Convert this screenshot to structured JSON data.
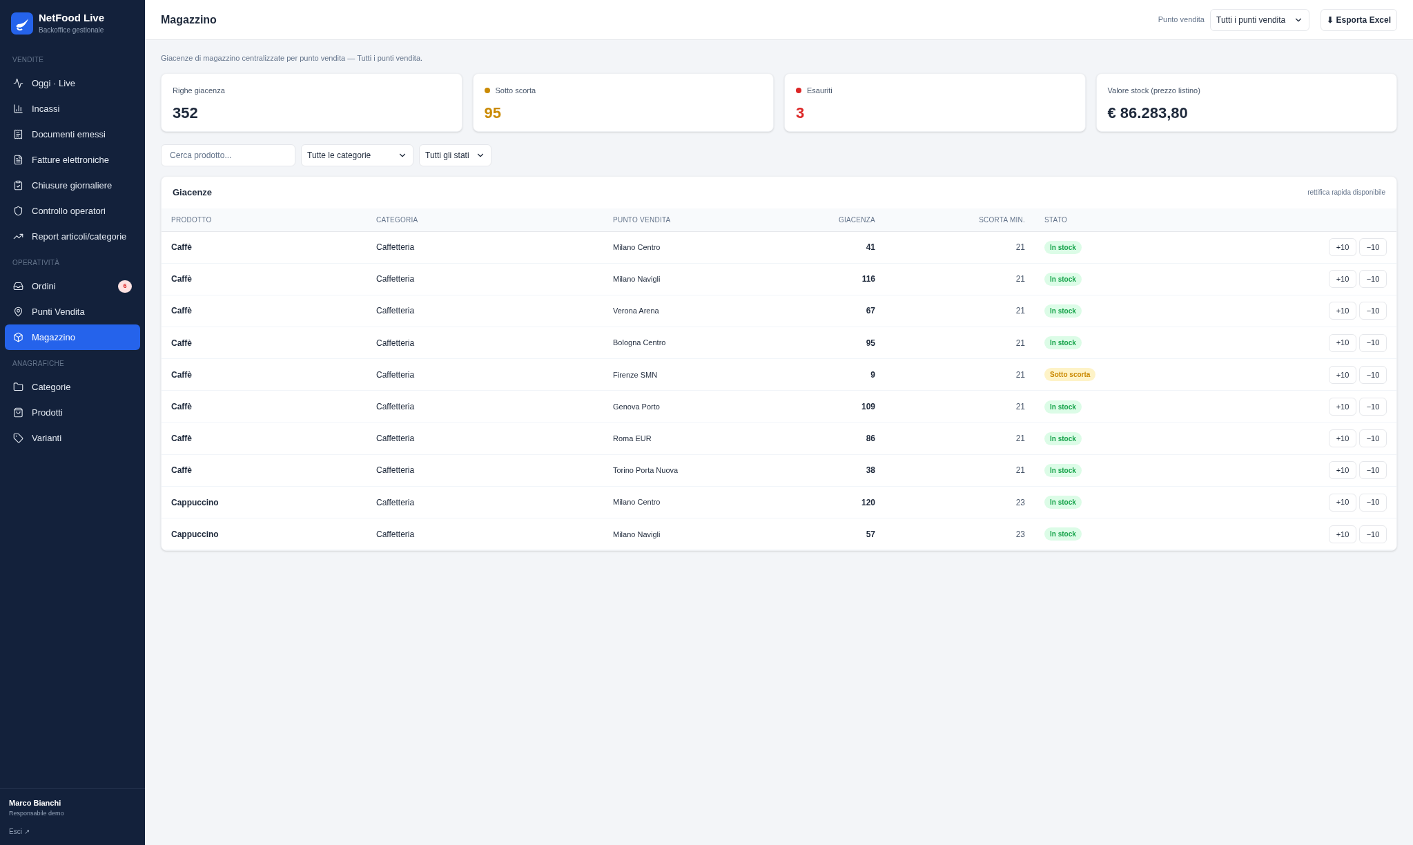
{
  "brand": {
    "name": "NetFood Live",
    "subtitle": "Backoffice gestionale"
  },
  "sidebar": {
    "sections": [
      {
        "title": "VENDITE",
        "items": [
          {
            "label": "Oggi · Live",
            "selected": false
          },
          {
            "label": "Incassi",
            "selected": false
          },
          {
            "label": "Documenti emessi",
            "selected": false
          },
          {
            "label": "Fatture elettroniche",
            "selected": false
          },
          {
            "label": "Chiusure giornaliere",
            "selected": false
          },
          {
            "label": "Controllo operatori",
            "selected": false
          },
          {
            "label": "Report articoli/categorie",
            "selected": false
          }
        ]
      },
      {
        "title": "OPERATIVITÀ",
        "items": [
          {
            "label": "Ordini",
            "selected": false,
            "badge": "6"
          },
          {
            "label": "Punti Vendita",
            "selected": false
          },
          {
            "label": "Magazzino",
            "selected": true
          }
        ]
      },
      {
        "title": "ANAGRAFICHE",
        "items": [
          {
            "label": "Categorie",
            "selected": false
          },
          {
            "label": "Prodotti",
            "selected": false
          },
          {
            "label": "Varianti",
            "selected": false
          }
        ]
      }
    ],
    "user": {
      "name": "Marco Bianchi",
      "role": "Responsabile demo",
      "logout": "Esci ↗"
    }
  },
  "header": {
    "title": "Magazzino",
    "store_label": "Punto vendita",
    "store_select": "Tutti i punti vendita",
    "export_button": "⬇ Esporta Excel"
  },
  "description": "Giacenze di magazzino centralizzate per punto vendita — Tutti i punti vendita.",
  "cards": [
    {
      "label": "Righe giacenza",
      "value": "352"
    },
    {
      "label": "Sotto scorta",
      "value": "95",
      "color": "#ca8a04"
    },
    {
      "label": "Esauriti",
      "value": "3",
      "color": "#dc2626"
    },
    {
      "label": "Valore stock (prezzo listino)",
      "value": "€ 86.283,80"
    }
  ],
  "filters": {
    "search_placeholder": "Cerca prodotto...",
    "category_select": "Tutte le categorie",
    "status_select": "Tutti gli stati"
  },
  "table": {
    "title": "Giacenze",
    "note": "rettifica rapida disponibile",
    "columns": [
      "PRODOTTO",
      "CATEGORIA",
      "PUNTO VENDITA",
      "GIACENZA",
      "SCORTA MIN.",
      "STATO"
    ],
    "rows": [
      {
        "product": "Caffè",
        "category": "Caffetteria",
        "store": "Milano Centro",
        "stock": "41",
        "min": "21",
        "status": "In stock",
        "kind": "ok",
        "plus": "+10",
        "minus": "−10"
      },
      {
        "product": "Caffè",
        "category": "Caffetteria",
        "store": "Milano Navigli",
        "stock": "116",
        "min": "21",
        "status": "In stock",
        "kind": "ok",
        "plus": "+10",
        "minus": "−10"
      },
      {
        "product": "Caffè",
        "category": "Caffetteria",
        "store": "Verona Arena",
        "stock": "67",
        "min": "21",
        "status": "In stock",
        "kind": "ok",
        "plus": "+10",
        "minus": "−10"
      },
      {
        "product": "Caffè",
        "category": "Caffetteria",
        "store": "Bologna Centro",
        "stock": "95",
        "min": "21",
        "status": "In stock",
        "kind": "ok",
        "plus": "+10",
        "minus": "−10"
      },
      {
        "product": "Caffè",
        "category": "Caffetteria",
        "store": "Firenze SMN",
        "stock": "9",
        "min": "21",
        "status": "Sotto scorta",
        "kind": "low",
        "plus": "+10",
        "minus": "−10"
      },
      {
        "product": "Caffè",
        "category": "Caffetteria",
        "store": "Genova Porto",
        "stock": "109",
        "min": "21",
        "status": "In stock",
        "kind": "ok",
        "plus": "+10",
        "minus": "−10"
      },
      {
        "product": "Caffè",
        "category": "Caffetteria",
        "store": "Roma EUR",
        "stock": "86",
        "min": "21",
        "status": "In stock",
        "kind": "ok",
        "plus": "+10",
        "minus": "−10"
      },
      {
        "product": "Caffè",
        "category": "Caffetteria",
        "store": "Torino Porta Nuova",
        "stock": "38",
        "min": "21",
        "status": "In stock",
        "kind": "ok",
        "plus": "+10",
        "minus": "−10"
      },
      {
        "product": "Cappuccino",
        "category": "Caffetteria",
        "store": "Milano Centro",
        "stock": "120",
        "min": "23",
        "status": "In stock",
        "kind": "ok",
        "plus": "+10",
        "minus": "−10"
      },
      {
        "product": "Cappuccino",
        "category": "Caffetteria",
        "store": "Milano Navigli",
        "stock": "57",
        "min": "23",
        "status": "In stock",
        "kind": "ok",
        "plus": "+10",
        "minus": "−10"
      }
    ]
  }
}
